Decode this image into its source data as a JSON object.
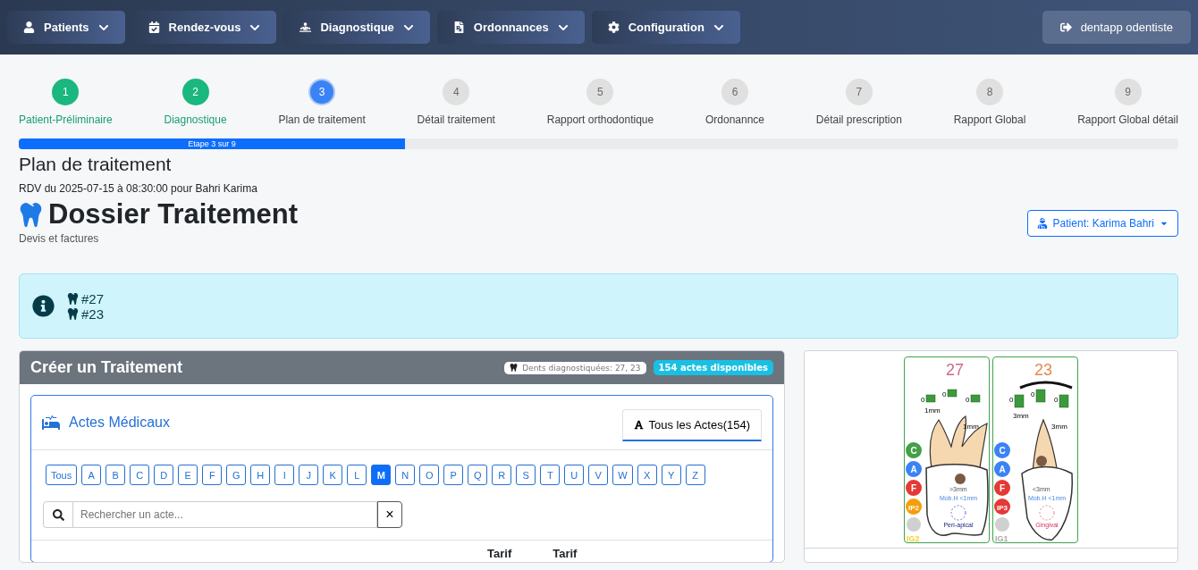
{
  "nav": {
    "menus": [
      {
        "label": "Patients"
      },
      {
        "label": "Rendez-vous"
      },
      {
        "label": "Diagnostique"
      },
      {
        "label": "Ordonnances"
      },
      {
        "label": "Configuration"
      }
    ],
    "account": "dentapp odentiste"
  },
  "stepper": {
    "steps": [
      {
        "number": "1",
        "label": "Patient-Préliminaire",
        "done": true,
        "selected": false
      },
      {
        "number": "2",
        "label": "Diagnostique",
        "done": true,
        "selected": false
      },
      {
        "number": "3",
        "label": "Plan de traitement",
        "done": false,
        "selected": true
      },
      {
        "number": "4",
        "label": "Détail traitement",
        "done": false,
        "selected": false
      },
      {
        "number": "5",
        "label": "Rapport orthodontique",
        "done": false,
        "selected": false
      },
      {
        "number": "6",
        "label": "Ordonannce",
        "done": false,
        "selected": false
      },
      {
        "number": "7",
        "label": "Détail prescription",
        "done": false,
        "selected": false
      },
      {
        "number": "8",
        "label": "Rapport Global",
        "done": false,
        "selected": false
      },
      {
        "number": "9",
        "label": "Rapport Global détail",
        "done": false,
        "selected": false
      }
    ],
    "progress": {
      "level": 0.333,
      "label": "Etape 3 sur 9"
    }
  },
  "page": {
    "title": "Plan de traitement",
    "appointment": "RDV du 2025-07-15 à 08:30:00 pour Bahri Karima",
    "heading": "Dossier Traitement",
    "subheading": "Devis et factures",
    "patient_button": "Patient: Karima Bahri"
  },
  "alert": {
    "teeth": [
      "#27",
      "#23"
    ]
  },
  "treatment_card": {
    "title": "Créer un Traitement",
    "teeth_badge": "Dents diagnostiquées: 27, 23",
    "count_badge": "154 actes disponibles",
    "acts": {
      "title": "Actes Médicaux",
      "tab": {
        "label": "Tous les Actes(154)",
        "selected": true
      },
      "letters": [
        {
          "label": "Tous",
          "selected": false
        },
        {
          "label": "A",
          "selected": false
        },
        {
          "label": "B",
          "selected": false
        },
        {
          "label": "C",
          "selected": false
        },
        {
          "label": "D",
          "selected": false
        },
        {
          "label": "E",
          "selected": false
        },
        {
          "label": "F",
          "selected": false
        },
        {
          "label": "G",
          "selected": false
        },
        {
          "label": "H",
          "selected": false
        },
        {
          "label": "I",
          "selected": false
        },
        {
          "label": "J",
          "selected": false
        },
        {
          "label": "K",
          "selected": false
        },
        {
          "label": "L",
          "selected": false
        },
        {
          "label": "M",
          "selected": true
        },
        {
          "label": "N",
          "selected": false
        },
        {
          "label": "O",
          "selected": false
        },
        {
          "label": "P",
          "selected": false
        },
        {
          "label": "Q",
          "selected": false
        },
        {
          "label": "R",
          "selected": false
        },
        {
          "label": "S",
          "selected": false
        },
        {
          "label": "T",
          "selected": false
        },
        {
          "label": "U",
          "selected": false
        },
        {
          "label": "V",
          "selected": false
        },
        {
          "label": "W",
          "selected": false
        },
        {
          "label": "X",
          "selected": false
        },
        {
          "label": "Y",
          "selected": false
        },
        {
          "label": "Z",
          "selected": false
        }
      ],
      "search": {
        "placeholder": "Rechercher un acte...",
        "clear": "×"
      },
      "table": {
        "columns": [
          "Tarif",
          "Tarif"
        ]
      }
    }
  },
  "teeth_chart": {
    "teeth": [
      {
        "number": "27",
        "color": "#c86b8a",
        "gauges": [
          "0",
          "0",
          "0"
        ],
        "pockets": [
          "1mm",
          "1mm"
        ],
        "badges": [
          {
            "label": "C",
            "color": "#43a047"
          },
          {
            "label": "A",
            "color": "#3b82f6"
          },
          {
            "label": "F",
            "color": "#e53935"
          },
          {
            "label": "IP2",
            "color": "#f59e0b"
          }
        ],
        "gum_label": {
          "label": "IG2",
          "color": "#f5d020"
        },
        "notes": [
          ">3mm",
          "Mob.H <1mm",
          "Peri-apical"
        ]
      },
      {
        "number": "23",
        "color": "#e08a50",
        "gauges": [
          "0",
          "0",
          "0"
        ],
        "pockets": [
          "3mm",
          "3mm"
        ],
        "badges": [
          {
            "label": "C",
            "color": "#3b82f6"
          },
          {
            "label": "A",
            "color": "#3b82f6"
          },
          {
            "label": "F",
            "color": "#e53935"
          },
          {
            "label": "IP3",
            "color": "#e53935"
          }
        ],
        "gum_label": {
          "label": "IG1",
          "color": "#a8a8a8"
        },
        "notes": [
          "<3mm",
          "Mob.H <1mm",
          "Gingival"
        ]
      }
    ]
  }
}
